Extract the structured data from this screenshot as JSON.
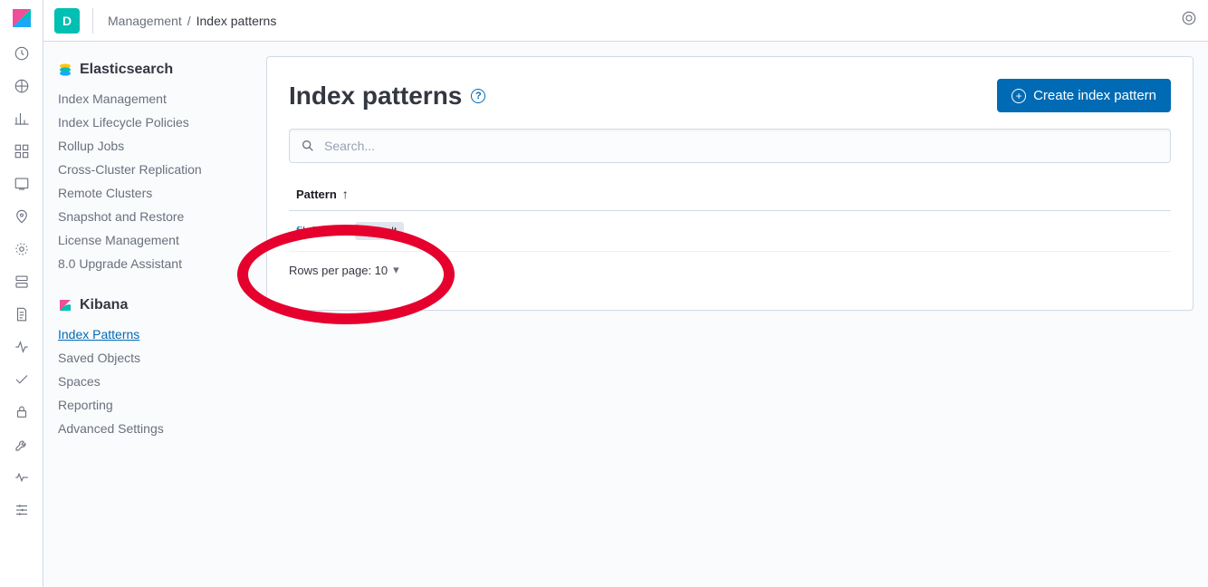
{
  "header": {
    "space_initial": "D",
    "breadcrumb_parent": "Management",
    "breadcrumb_current": "Index patterns"
  },
  "sidebar": {
    "elasticsearch": {
      "title": "Elasticsearch",
      "items": [
        "Index Management",
        "Index Lifecycle Policies",
        "Rollup Jobs",
        "Cross-Cluster Replication",
        "Remote Clusters",
        "Snapshot and Restore",
        "License Management",
        "8.0 Upgrade Assistant"
      ]
    },
    "kibana": {
      "title": "Kibana",
      "items": [
        "Index Patterns",
        "Saved Objects",
        "Spaces",
        "Reporting",
        "Advanced Settings"
      ],
      "active_index": 0
    }
  },
  "main": {
    "title": "Index patterns",
    "create_button": "Create index pattern",
    "search_placeholder": "Search...",
    "column_header": "Pattern",
    "rows": [
      {
        "name": "filebeat-*",
        "badge": "Default"
      }
    ],
    "pager_label": "Rows per page: 10"
  }
}
